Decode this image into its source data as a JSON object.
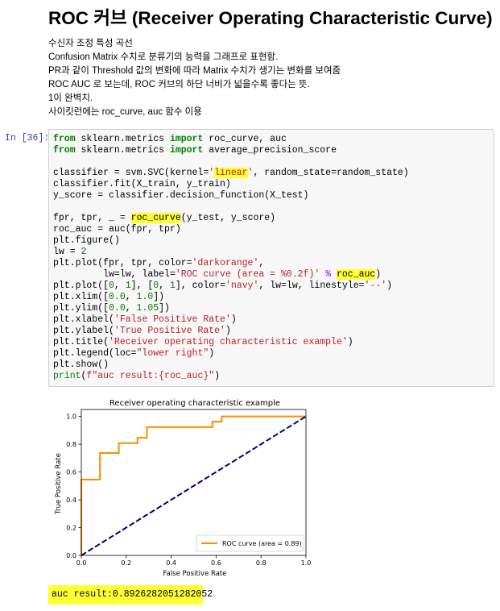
{
  "markdown": {
    "title": "ROC 커브 (Receiver Operating Characteristic Curve)",
    "lines": [
      "수신자 조정 특성 곡선",
      "Confusion Matrix 수치로 분류기의 능력을 그래프로 표현함.",
      "PR과 같이 Threshold 값의 변화에 따라 Matrix 수치가 생기는 변화를 보여줌",
      "ROC AUC 로 보는데, ROC 커브의 하단 너비가 넓을수록 좋다는 뜻.",
      "1이 완벽치.",
      "사이킷런에는 roc_curve, auc 함수 이용"
    ]
  },
  "cell": {
    "prompt": "In [36]:",
    "output": "auc result:0.8926282051282052"
  },
  "chart_data": {
    "type": "line",
    "title": "Receiver operating characteristic example",
    "xlabel": "False Positive Rate",
    "ylabel": "True Positive Rate",
    "xlim": [
      0.0,
      1.0
    ],
    "ylim": [
      0.0,
      1.05
    ],
    "xticks": [
      "0.0",
      "0.2",
      "0.4",
      "0.6",
      "0.8",
      "1.0"
    ],
    "yticks": [
      "0.0",
      "0.2",
      "0.4",
      "0.6",
      "0.8",
      "1.0"
    ],
    "legend_position": "lower right",
    "grid": false,
    "series": [
      {
        "name": "ROC curve (area = 0.89)",
        "color": "#ff8c00",
        "style": "solid",
        "x": [
          0.0,
          0.0,
          0.083,
          0.083,
          0.167,
          0.167,
          0.25,
          0.25,
          0.292,
          0.292,
          0.583,
          0.583,
          0.625,
          0.625,
          1.0
        ],
        "y": [
          0.0,
          0.545,
          0.545,
          0.737,
          0.737,
          0.808,
          0.808,
          0.846,
          0.846,
          0.923,
          0.923,
          0.962,
          0.962,
          1.0,
          1.0
        ]
      },
      {
        "color": "#000080",
        "style": "dashed",
        "x": [
          0.0,
          1.0
        ],
        "y": [
          0.0,
          1.0
        ]
      }
    ]
  }
}
